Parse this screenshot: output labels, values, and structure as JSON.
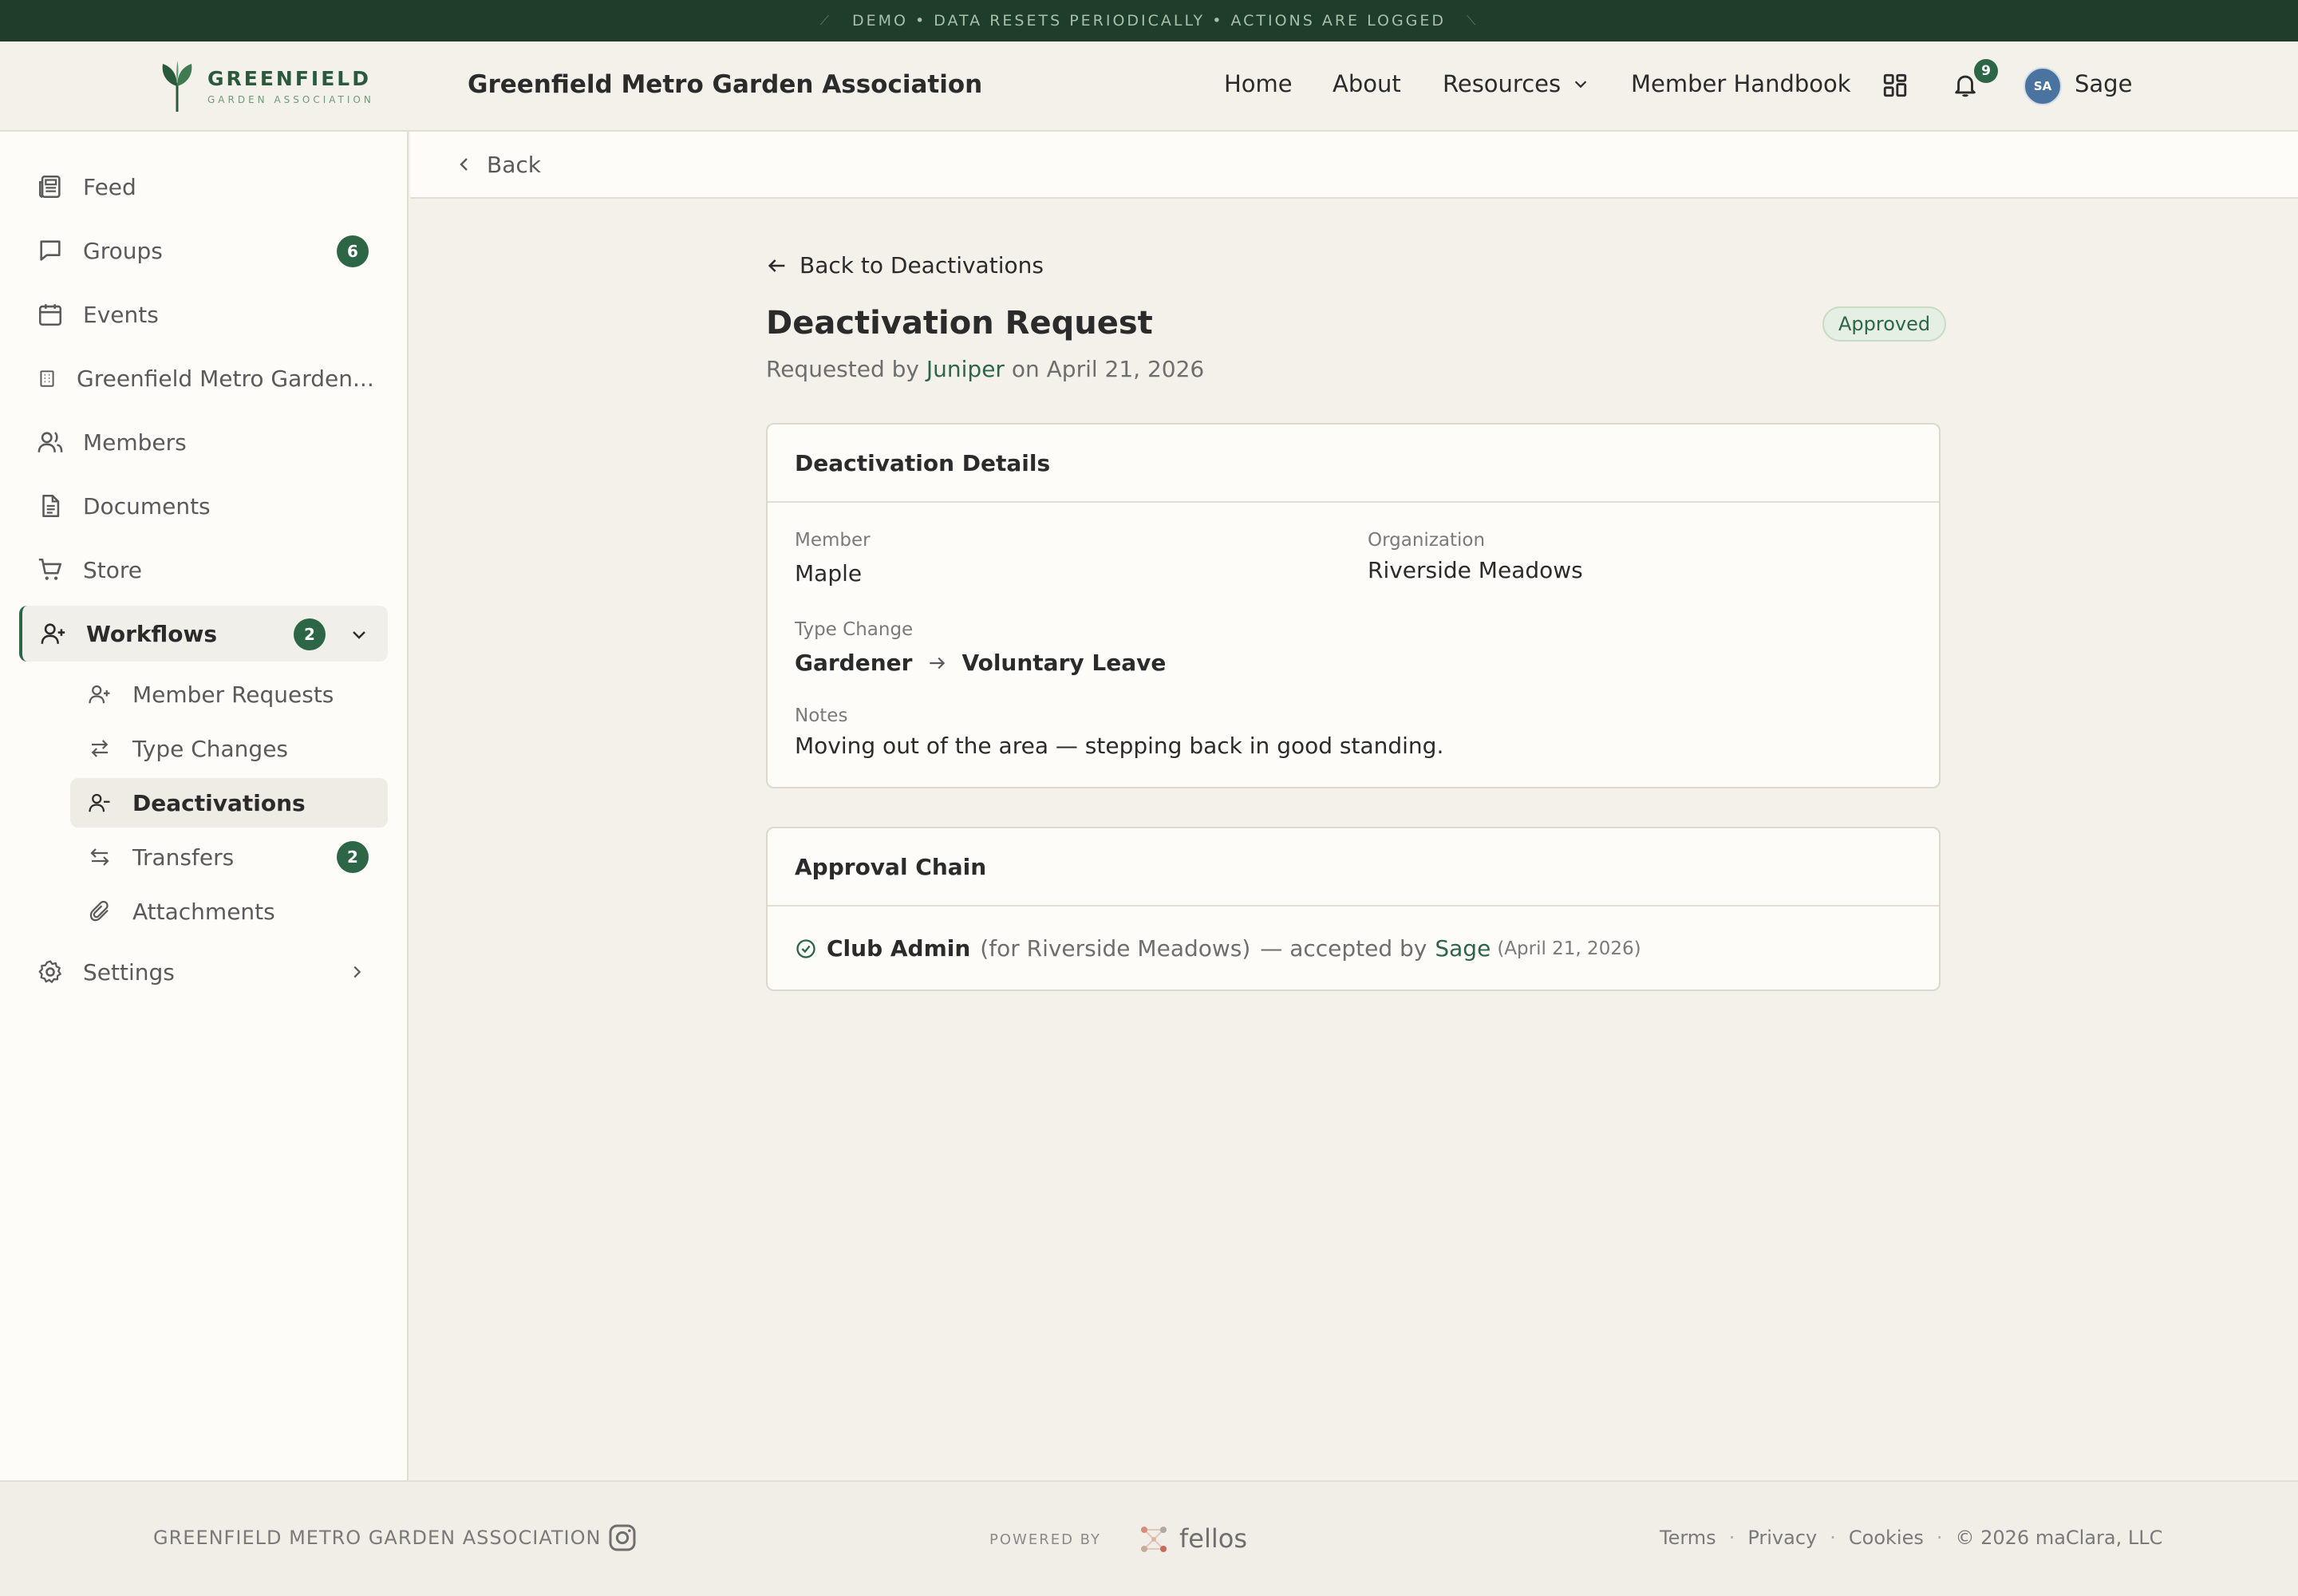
{
  "banner": {
    "text": "DEMO • DATA RESETS PERIODICALLY • ACTIONS ARE LOGGED"
  },
  "header": {
    "logo_name": "GREENFIELD",
    "logo_sub": "GARDEN ASSOCIATION",
    "site_title": "Greenfield Metro Garden Association",
    "nav": {
      "home": "Home",
      "about": "About",
      "resources": "Resources",
      "handbook": "Member Handbook"
    },
    "notification_count": "9",
    "avatar_initials": "SA",
    "user_name": "Sage"
  },
  "sidebar": {
    "feed": "Feed",
    "groups": "Groups",
    "groups_badge": "6",
    "events": "Events",
    "org": "Greenfield Metro Garden...",
    "members": "Members",
    "documents": "Documents",
    "store": "Store",
    "workflows": "Workflows",
    "workflows_badge": "2",
    "sub": {
      "member_requests": "Member Requests",
      "type_changes": "Type Changes",
      "deactivations": "Deactivations",
      "transfers": "Transfers",
      "transfers_badge": "2",
      "attachments": "Attachments"
    },
    "settings": "Settings"
  },
  "backbar": {
    "label": "Back"
  },
  "main": {
    "back_link": "Back to Deactivations",
    "title": "Deactivation Request",
    "status": "Approved",
    "requested_prefix": "Requested by",
    "requested_by": "Juniper",
    "requested_on_prefix": "on",
    "requested_date": "April 21, 2026",
    "details": {
      "heading": "Deactivation Details",
      "member_label": "Member",
      "member_value": "Maple",
      "org_label": "Organization",
      "org_value": "Riverside Meadows",
      "type_change_label": "Type Change",
      "type_from": "Gardener",
      "type_to": "Voluntary Leave",
      "notes_label": "Notes",
      "notes_value": "Moving out of the area — stepping back in good standing."
    },
    "chain": {
      "heading": "Approval Chain",
      "role": "Club Admin",
      "scope": "(for Riverside Meadows)",
      "accepted_text": "— accepted by",
      "accepted_by": "Sage",
      "date": "(April 21, 2026)"
    }
  },
  "footer": {
    "org": "GREENFIELD METRO GARDEN ASSOCIATION",
    "powered_by": "POWERED BY",
    "brand": "fellos",
    "terms": "Terms",
    "privacy": "Privacy",
    "cookies": "Cookies",
    "copyright": "© 2026 maClara, LLC"
  },
  "colors": {
    "accent": "#2d6647",
    "banner_bg": "#1e3d2a",
    "page_bg": "#f4f1eb",
    "approved_bg": "#e6efe3"
  }
}
